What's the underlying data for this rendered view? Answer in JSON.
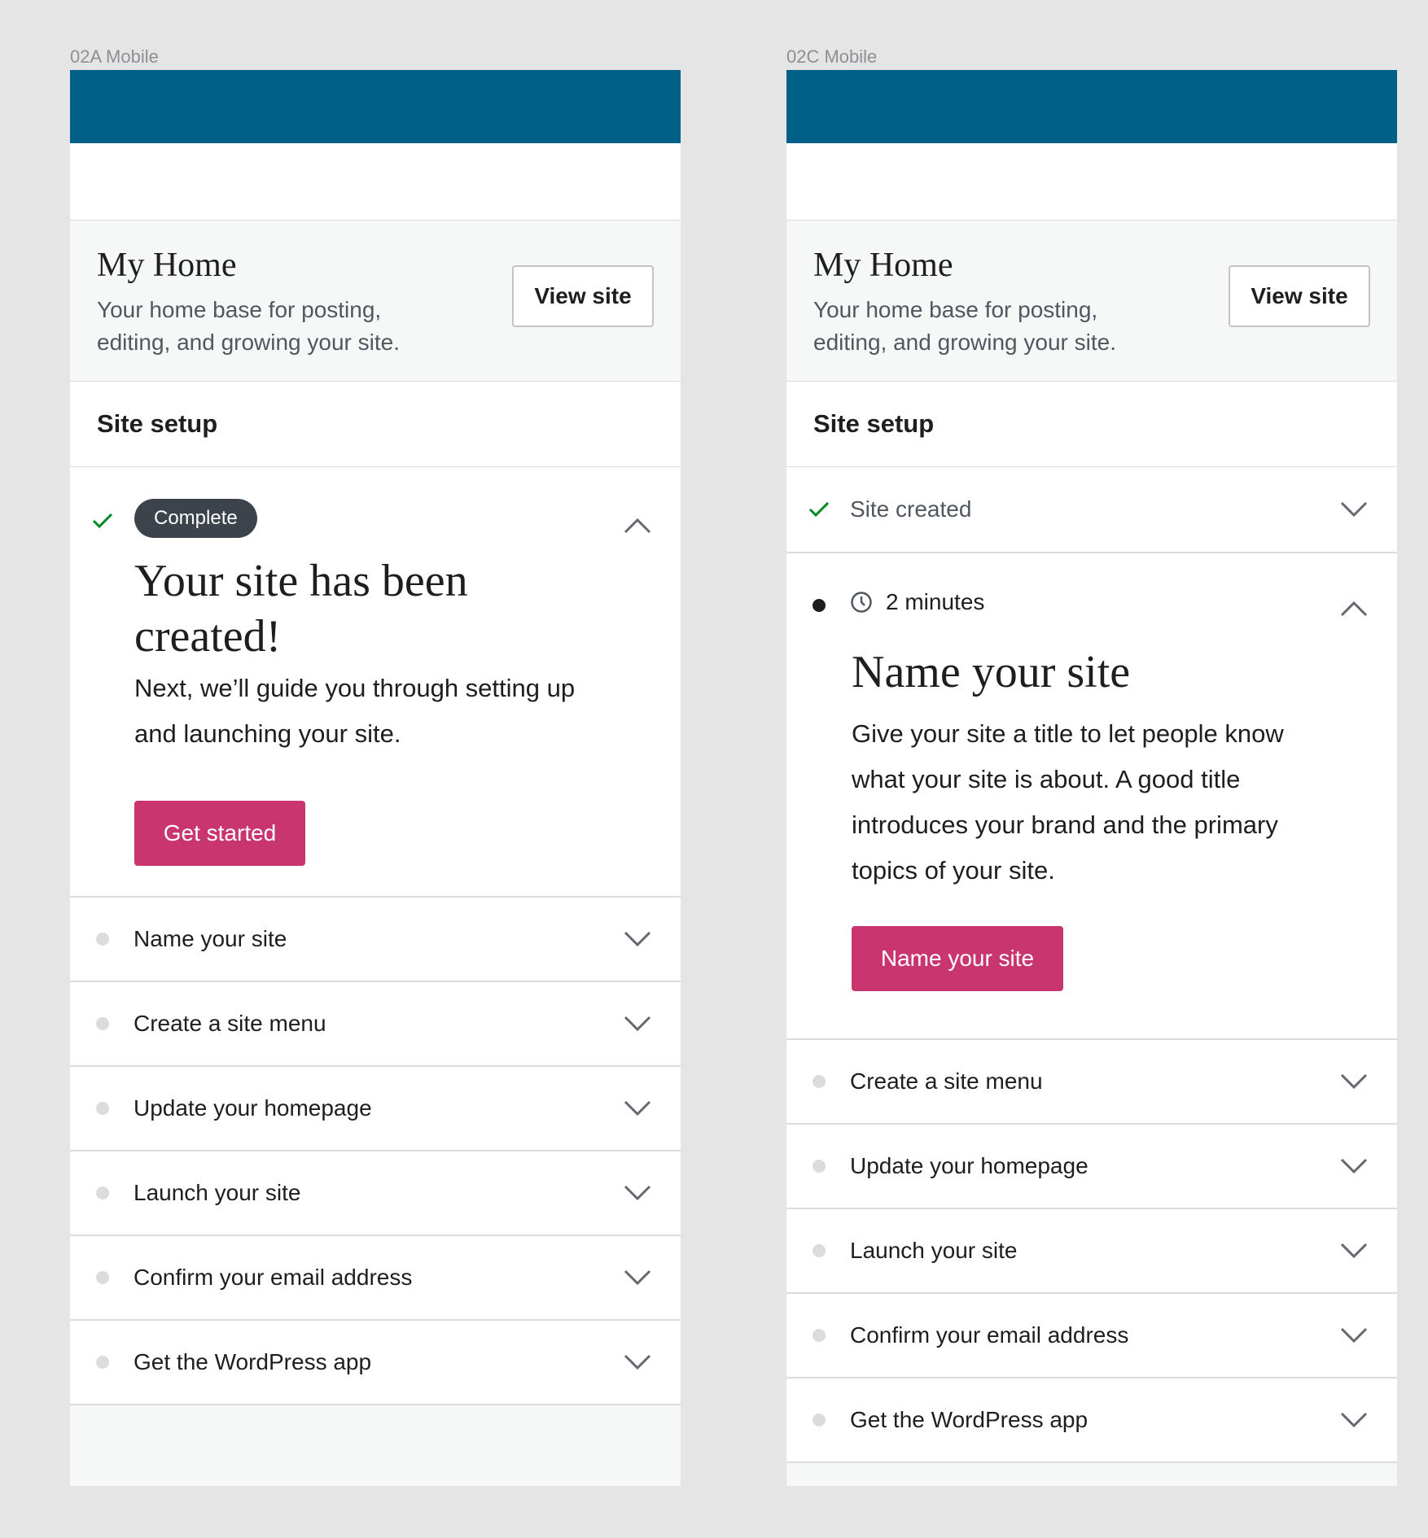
{
  "frames": [
    {
      "label": "02A Mobile",
      "header": {
        "title": "My Home",
        "subtitle": "Your home base for posting, editing, and growing your site.",
        "view_site": "View site"
      },
      "setup_title": "Site setup",
      "active_task": {
        "badge": "Complete",
        "title": "Your site has been created!",
        "body": "Next, we’ll guide you through setting up and launching your site.",
        "button": "Get started"
      },
      "tasks": [
        {
          "label": "Name your site"
        },
        {
          "label": "Create a site menu"
        },
        {
          "label": "Update your homepage"
        },
        {
          "label": "Launch your site"
        },
        {
          "label": "Confirm your email address"
        },
        {
          "label": "Get the WordPress app"
        }
      ]
    },
    {
      "label": "02C Mobile",
      "header": {
        "title": "My Home",
        "subtitle": "Your home base for posting, editing, and growing your site.",
        "view_site": "View site"
      },
      "setup_title": "Site setup",
      "completed_task": {
        "label": "Site created"
      },
      "active_task": {
        "time": "2 minutes",
        "title": "Name your site",
        "body": "Give your site a title to let people know what your site is about. A good title introduces your brand and the primary topics of your site.",
        "button": "Name your site"
      },
      "tasks": [
        {
          "label": "Create a site menu"
        },
        {
          "label": "Update your homepage"
        },
        {
          "label": "Launch your site"
        },
        {
          "label": "Confirm your email address"
        },
        {
          "label": "Get the WordPress app"
        }
      ]
    }
  ],
  "colors": {
    "masterbar": "#006088",
    "primary_button": "#c9356e",
    "complete_badge": "#3c434a",
    "check": "#008a20"
  },
  "icons": {
    "check": "checkmark-icon",
    "chevron_down": "chevron-down-icon",
    "chevron_up": "chevron-up-icon",
    "clock": "clock-icon"
  }
}
